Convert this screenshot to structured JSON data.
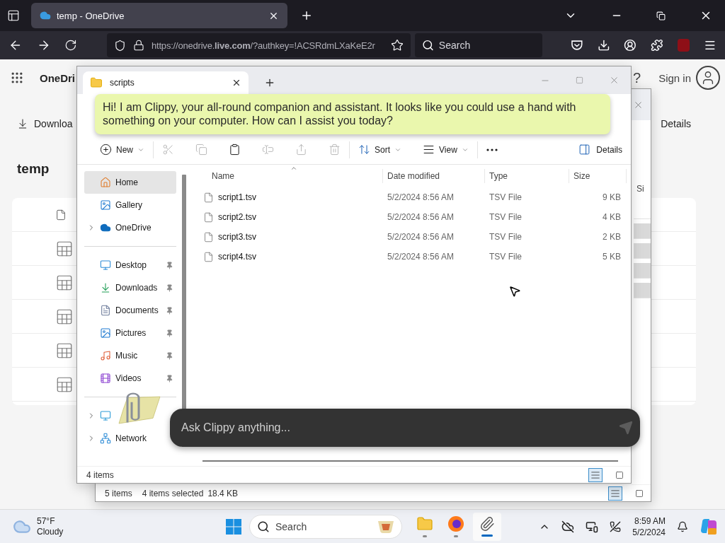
{
  "browser": {
    "tabs": [
      {
        "title": "temp - OneDrive",
        "selected": true
      }
    ],
    "url": "https://onedrive.**live.com**/?authkey=!ACSRdmLXaKeE2r",
    "search": {
      "placeholder": "Search"
    }
  },
  "onedrive": {
    "app_name": "OneDri",
    "help": "?",
    "sign_in": "Sign in",
    "commands": [
      "Downloa",
      "Details"
    ],
    "folder": "temp"
  },
  "back_window": {
    "column": "Si",
    "rows": [
      {
        "selected": false
      },
      {
        "selected": true
      },
      {
        "selected": true
      },
      {
        "selected": true
      },
      {
        "selected": true
      }
    ],
    "status": {
      "count": "5 items",
      "selection": "4 items selected",
      "size": "18.4 KB"
    },
    "views": [
      {
        "kind": "details",
        "selected": true
      },
      {
        "kind": "tiles",
        "selected": false
      }
    ]
  },
  "explorer": {
    "tab": "scripts",
    "toolbar": [
      [
        {
          "kind": "new",
          "label": "New",
          "dropdown": true,
          "disabled": false
        }
      ],
      [
        {
          "kind": "cut",
          "disabled": true
        },
        {
          "kind": "copy",
          "disabled": true
        },
        {
          "kind": "paste",
          "disabled": false
        },
        {
          "kind": "rename",
          "disabled": true
        },
        {
          "kind": "share",
          "disabled": true
        },
        {
          "kind": "delete",
          "disabled": true
        }
      ],
      [
        {
          "kind": "sort",
          "label": "Sort",
          "dropdown": true,
          "disabled": false
        },
        {
          "kind": "view",
          "label": "View",
          "dropdown": true,
          "disabled": false
        }
      ],
      [
        {
          "kind": "more",
          "disabled": false
        }
      ]
    ],
    "details_button": "Details",
    "nav": [
      [
        {
          "kind": "home",
          "label": "Home",
          "selected": true,
          "expandable": false,
          "pinned": false
        },
        {
          "kind": "gallery",
          "label": "Gallery",
          "selected": false,
          "expandable": false,
          "pinned": false
        },
        {
          "kind": "cloud",
          "label": "OneDrive",
          "selected": false,
          "expandable": true,
          "pinned": false
        }
      ],
      [
        {
          "kind": "desktop",
          "label": "Desktop",
          "selected": false,
          "expandable": false,
          "pinned": true
        },
        {
          "kind": "downloads",
          "label": "Downloads",
          "selected": false,
          "expandable": false,
          "pinned": true
        },
        {
          "kind": "documents",
          "label": "Documents",
          "selected": false,
          "expandable": false,
          "pinned": true
        },
        {
          "kind": "pictures",
          "label": "Pictures",
          "selected": false,
          "expandable": false,
          "pinned": true
        },
        {
          "kind": "music",
          "label": "Music",
          "selected": false,
          "expandable": false,
          "pinned": true
        },
        {
          "kind": "videos",
          "label": "Videos",
          "selected": false,
          "expandable": false,
          "pinned": true
        }
      ],
      [
        {
          "kind": "pc",
          "selected": false,
          "expandable": true,
          "pinned": false
        },
        {
          "kind": "network",
          "label": "Network",
          "selected": false,
          "expandable": true,
          "pinned": false
        }
      ]
    ],
    "columns": [
      "Name",
      "Date modified",
      "Type",
      "Size"
    ],
    "files": [
      {
        "name": "script1.tsv",
        "date": "5/2/2024 8:56 AM",
        "type": "TSV File",
        "size": "9 KB"
      },
      {
        "name": "script2.tsv",
        "date": "5/2/2024 8:56 AM",
        "type": "TSV File",
        "size": "4 KB"
      },
      {
        "name": "script3.tsv",
        "date": "5/2/2024 8:56 AM",
        "type": "TSV File",
        "size": "2 KB"
      },
      {
        "name": "script4.tsv",
        "date": "5/2/2024 8:56 AM",
        "type": "TSV File",
        "size": "5 KB"
      }
    ],
    "status": "4 items",
    "views": [
      {
        "kind": "details",
        "selected": true
      },
      {
        "kind": "tiles",
        "selected": false
      }
    ]
  },
  "clippy": {
    "message": "Hi! I am Clippy, your all-round companion and assistant. It looks like you could use a hand with something on your computer. How can I assist you today?",
    "placeholder": "Ask Clippy anything..."
  },
  "taskbar": {
    "weather": {
      "temperature": "57°F",
      "condition": "Cloudy"
    },
    "search": {
      "placeholder": "Search"
    },
    "apps": [
      {
        "kind": "files",
        "selected": false
      },
      {
        "kind": "browser",
        "selected": false
      },
      {
        "kind": "paperclip",
        "selected": true
      }
    ],
    "clock": {
      "time": "8:59 AM",
      "date": "5/2/2024"
    }
  }
}
